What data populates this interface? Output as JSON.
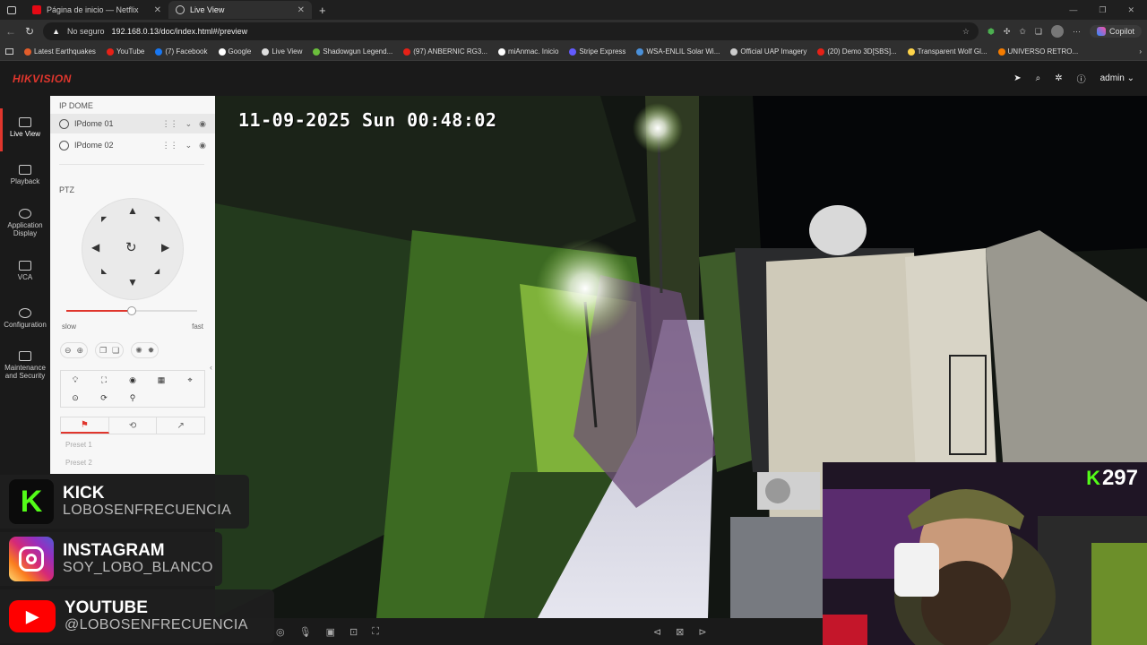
{
  "browser": {
    "tabs": [
      {
        "title": "Página de inicio — Netflix",
        "icon": "netflix-icon"
      },
      {
        "title": "Live View",
        "icon": "live-view-icon"
      }
    ],
    "security": "No seguro",
    "url": "192.168.0.13/doc/index.html#/preview",
    "copilot": "Copilot",
    "bookmarks": [
      {
        "label": "Latest Earthquakes",
        "color": "#e25d2b"
      },
      {
        "label": "YouTube",
        "color": "#e62117"
      },
      {
        "label": "(7) Facebook",
        "color": "#1877f2"
      },
      {
        "label": "Google",
        "color": "#ffffff"
      },
      {
        "label": "Live View",
        "color": "#dddddd"
      },
      {
        "label": "Shadowgun Legend...",
        "color": "#6bbf3c"
      },
      {
        "label": "(97) ANBERNIC RG3...",
        "color": "#e62117"
      },
      {
        "label": "miAnmac. Inicio",
        "color": "#ffffff"
      },
      {
        "label": "Stripe Express",
        "color": "#635bff"
      },
      {
        "label": "WSA-ENLIL Solar Wi...",
        "color": "#4a90d9"
      },
      {
        "label": "Official UAP Imagery",
        "color": "#cccccc"
      },
      {
        "label": "(20) Demo 3D[SBS]...",
        "color": "#e62117"
      },
      {
        "label": "Transparent Wolf Gl...",
        "color": "#ffd54a"
      },
      {
        "label": "UNIVERSO RETRO...",
        "color": "#f57c00"
      }
    ]
  },
  "app": {
    "logo": "HIKVISION",
    "brand_color": "#e0362d",
    "user": "admin"
  },
  "nav": [
    {
      "label": "Live View",
      "icon": "monitor-icon"
    },
    {
      "label": "Playback",
      "icon": "playback-icon"
    },
    {
      "label": "Application Display",
      "icon": "application-icon"
    },
    {
      "label": "VCA",
      "icon": "vca-icon"
    },
    {
      "label": "Configuration",
      "icon": "gear-icon"
    },
    {
      "label": "Maintenance and Security",
      "icon": "maintenance-icon"
    }
  ],
  "panel": {
    "group": "IP DOME",
    "cameras": [
      "IPdome 01",
      "IPdome 02"
    ],
    "ptz_label": "PTZ",
    "speed_slow": "slow",
    "speed_fast": "fast",
    "speed_level": 0.5,
    "presets": [
      "Preset 1",
      "Preset 2"
    ]
  },
  "video": {
    "osd": "11-09-2025 Sun 00:48:02"
  },
  "overlays": [
    {
      "title": "KICK",
      "sub": "LOBOSENFRECUENCIA",
      "color": "#53fc18"
    },
    {
      "title": "INSTAGRAM",
      "sub": "SOY_LOBO_BLANCO",
      "color": "#d62976"
    },
    {
      "title": "YOUTUBE",
      "sub": "@LOBOSENFRECUENCIA",
      "color": "#ff0000"
    }
  ],
  "stream": {
    "viewers": "297",
    "platform_letter": "K"
  }
}
